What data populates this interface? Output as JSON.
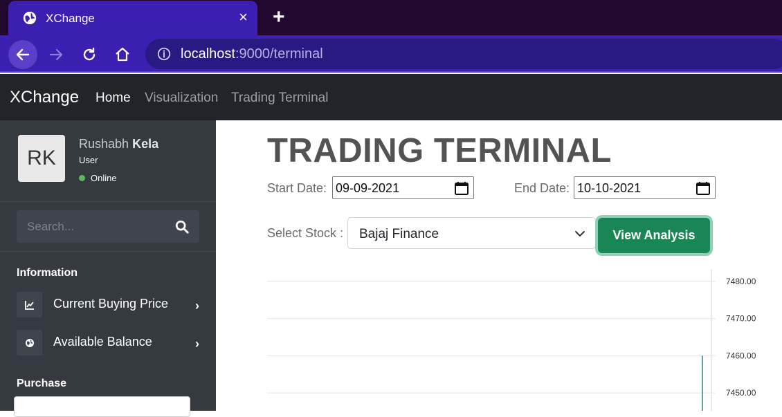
{
  "browser": {
    "tab_title": "XChange",
    "url_host": "localhost",
    "url_path": ":9000/terminal",
    "new_tab_symbol": "+",
    "close_symbol": "×"
  },
  "navbar": {
    "brand": "XChange",
    "links": [
      "Home",
      "Visualization",
      "Trading Terminal"
    ]
  },
  "sidebar": {
    "avatar_initials": "RK",
    "first_name": "Rushabh",
    "last_name": "Kela",
    "role": "User",
    "status": "Online",
    "search_placeholder": "Search...",
    "information_heading": "Information",
    "items": [
      {
        "label": "Current Buying Price",
        "icon": "chart-line-icon"
      },
      {
        "label": "Available Balance",
        "icon": "globe-icon"
      }
    ],
    "purchase_heading": "Purchase"
  },
  "main": {
    "heading": "TRADING TERMINAL",
    "start_label": "Start Date:",
    "start_value": "09-09-2021",
    "end_label": "End Date:",
    "end_value": "10-10-2021",
    "stock_label": "Select Stock :",
    "stock_value": "Bajaj Finance",
    "button": "View Analysis"
  },
  "colors": {
    "tab_strip": "#22072e",
    "toolbar": "#3a1fb0",
    "navbar": "#212529",
    "sidebar": "#343a40",
    "button": "#198754",
    "status_online": "#5cb85c"
  },
  "chart_data": {
    "type": "line",
    "y_ticks": [
      "7480.00",
      "7470.00",
      "7460.00",
      "7450.00"
    ],
    "y_tick_values": [
      7480,
      7470,
      7460,
      7450
    ],
    "series": [
      {
        "values": [
          7460,
          7445
        ]
      }
    ]
  }
}
